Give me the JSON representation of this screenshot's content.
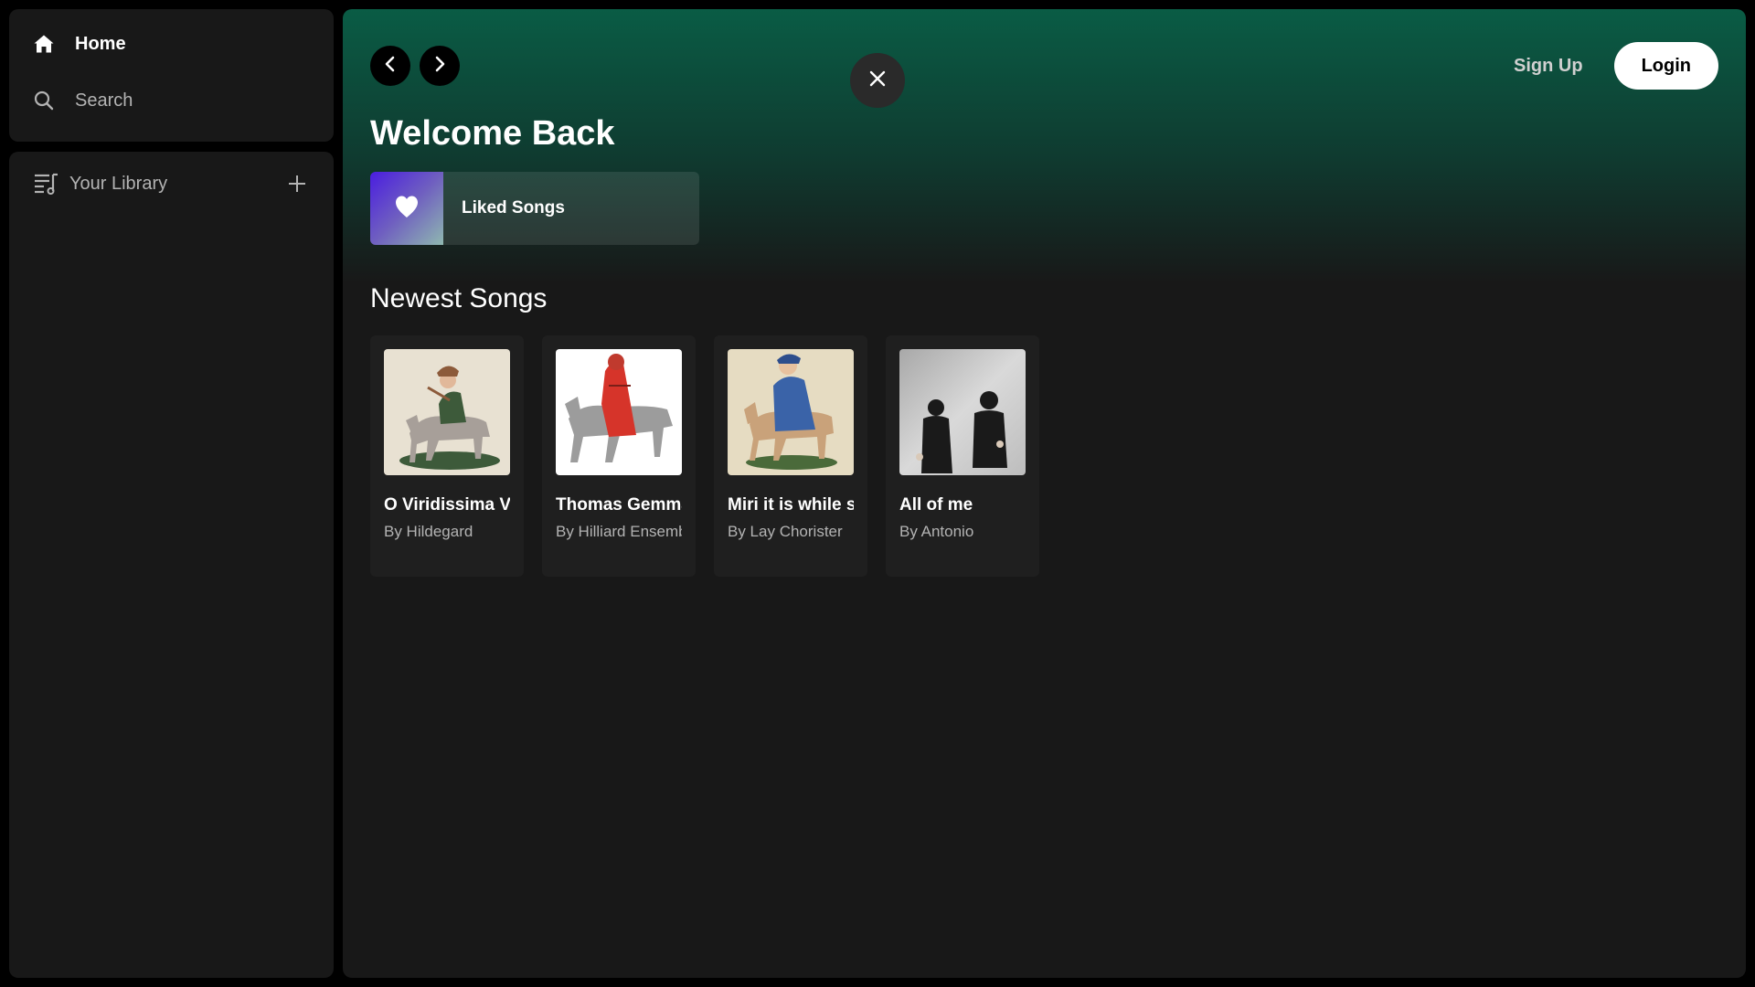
{
  "sidebar": {
    "nav": [
      {
        "label": "Home",
        "icon": "home-icon",
        "active": true
      },
      {
        "label": "Search",
        "icon": "search-icon",
        "active": false
      }
    ],
    "library": {
      "label": "Your Library",
      "icon": "library-icon",
      "add_icon": "plus-icon"
    }
  },
  "header": {
    "back_icon": "chevron-left-icon",
    "forward_icon": "chevron-right-icon",
    "close_icon": "close-icon",
    "signup_label": "Sign Up",
    "login_label": "Login"
  },
  "main": {
    "welcome": "Welcome Back",
    "liked": {
      "label": "Liked Songs",
      "icon": "heart-icon"
    },
    "section_title": "Newest Songs",
    "songs": [
      {
        "title": "O Viridissima Virga",
        "artist": "By Hildegard"
      },
      {
        "title": "Thomas Gemma",
        "artist": "By Hilliard Ensemble"
      },
      {
        "title": "Miri it is while sumer ilast",
        "artist": "By Lay Chorister"
      },
      {
        "title": "All of me",
        "artist": "By Antonio"
      }
    ]
  },
  "colors": {
    "accent_green": "#0a5c45",
    "panel": "#181818",
    "card": "#1f1f1f",
    "muted_text": "#b3b3b3"
  }
}
